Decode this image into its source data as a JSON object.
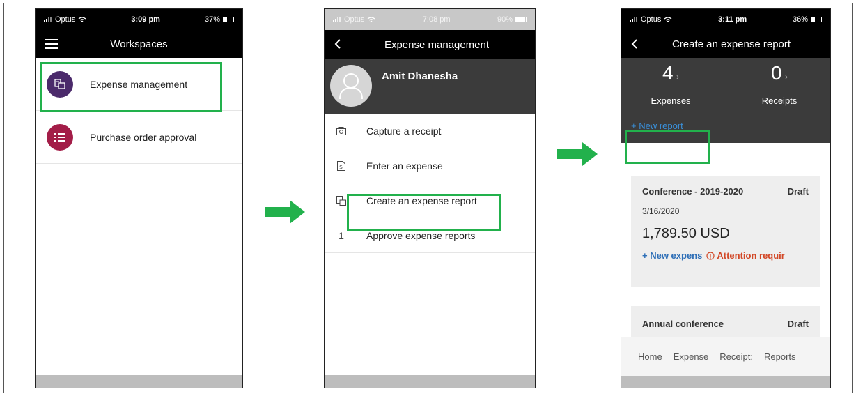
{
  "phone1": {
    "status": {
      "carrier": "Optus",
      "time": "3:09 pm",
      "battery": "37%",
      "battery_level": 0.37
    },
    "nav_title": "Workspaces",
    "items": [
      {
        "label": "Expense management",
        "icon": "expense-report-icon",
        "color": "#4b2a6b"
      },
      {
        "label": "Purchase order approval",
        "icon": "list-icon",
        "color": "#a31d48"
      }
    ]
  },
  "phone2": {
    "status": {
      "carrier": "Optus",
      "time": "7:08 pm",
      "battery": "90%",
      "battery_level": 0.9
    },
    "nav_title": "Expense management",
    "profile_name": "Amit Dhanesha",
    "menu": [
      {
        "label": "Capture a receipt",
        "icon": "camera-icon"
      },
      {
        "label": "Enter an expense",
        "icon": "receipt-icon"
      },
      {
        "label": "Create an expense report",
        "icon": "expense-report-icon"
      },
      {
        "label": "Approve expense reports",
        "badge": "1"
      }
    ]
  },
  "phone3": {
    "status": {
      "carrier": "Optus",
      "time": "3:11 pm",
      "battery": "36%",
      "battery_level": 0.36
    },
    "nav_title": "Create an expense report",
    "expenses": {
      "count": "4",
      "label": "Expenses"
    },
    "receipts": {
      "count": "0",
      "label": "Receipts"
    },
    "new_report": "+ New report",
    "card1": {
      "title": "Conference - 2019-2020",
      "status": "Draft",
      "date": "3/16/2020",
      "amount": "1,789.50 USD",
      "new_expense": "+ New expens",
      "attention": "Attention requir"
    },
    "card2": {
      "title": "Annual conference",
      "status": "Draft"
    },
    "tabs": [
      "Home",
      "Expense",
      "Receipt:",
      "Reports"
    ]
  },
  "colors": {
    "highlight": "#22b14c",
    "accent_blue": "#3a8fd8",
    "warning_red": "#d24726"
  }
}
